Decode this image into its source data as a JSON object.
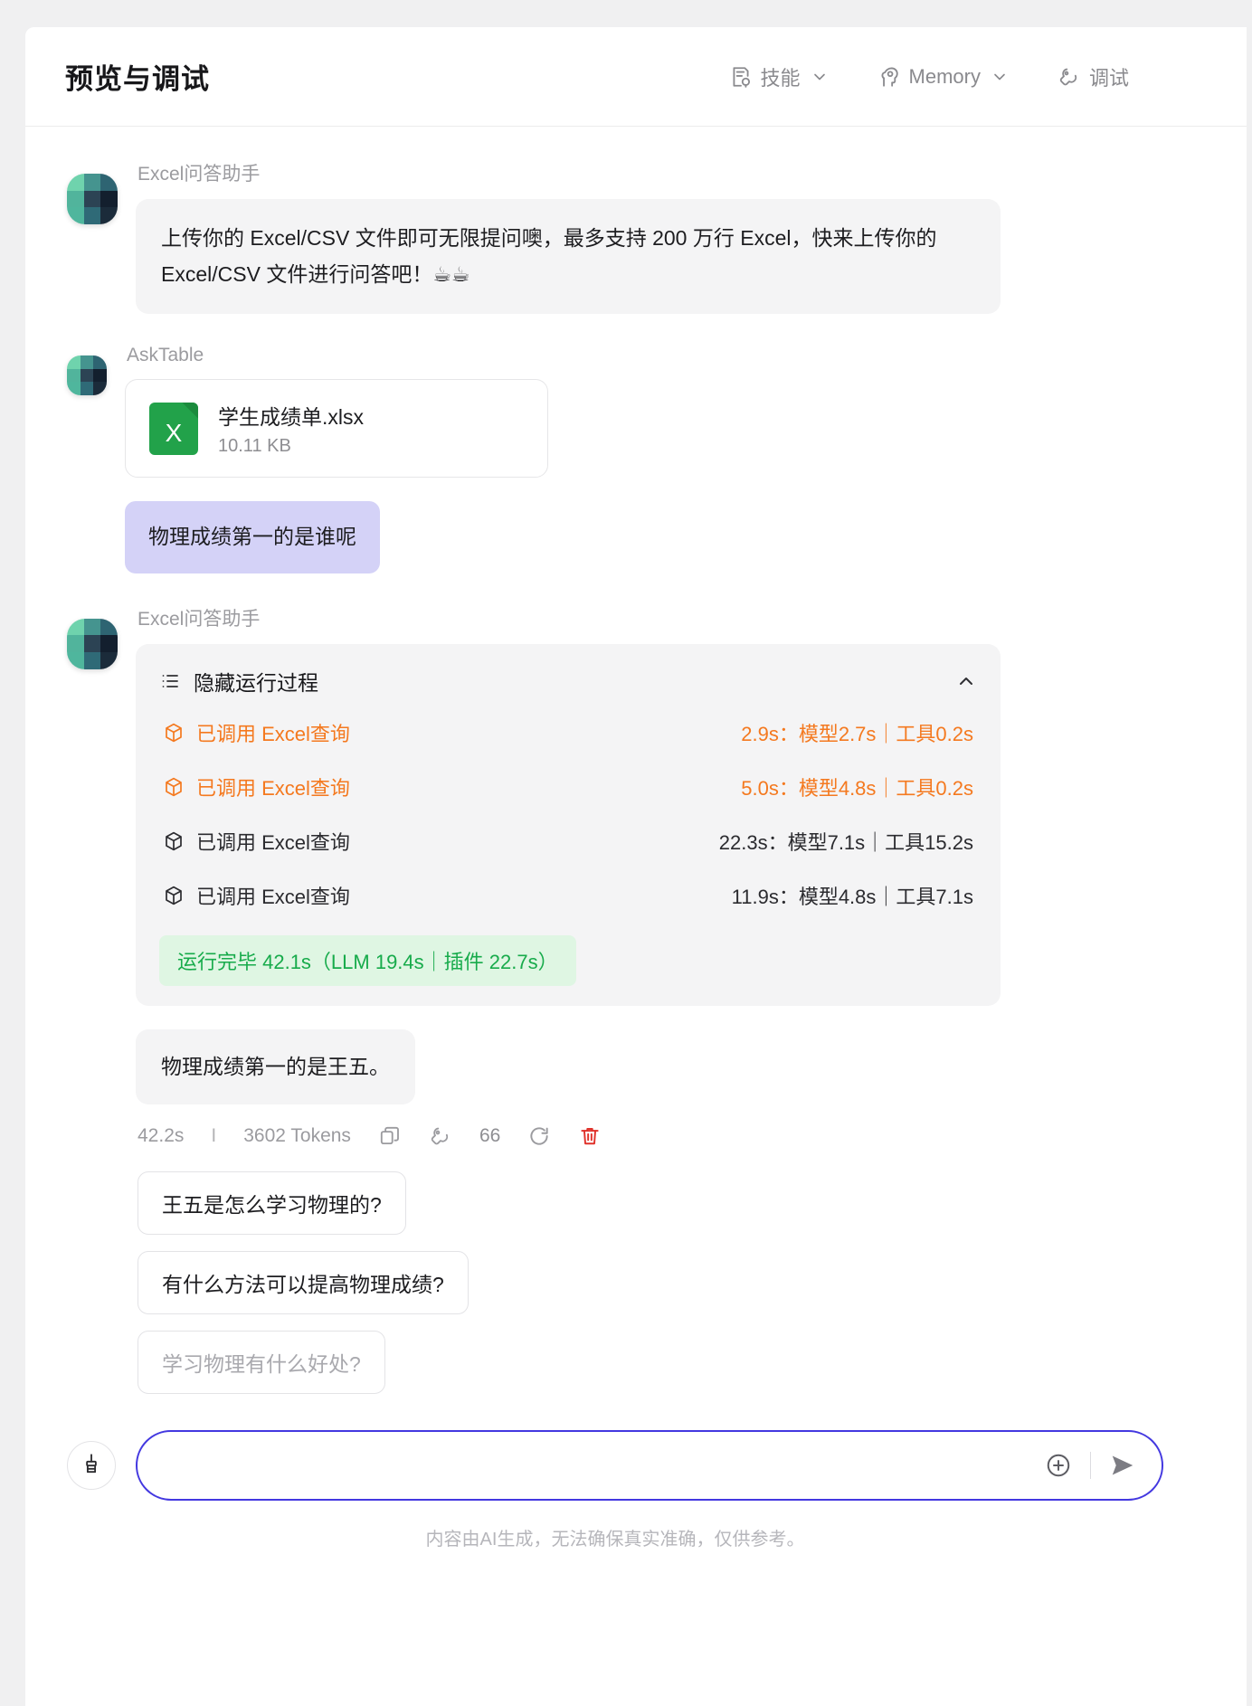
{
  "header": {
    "title": "预览与调试",
    "actions": [
      {
        "label": "技能",
        "icon": "skills-icon",
        "has_caret": true
      },
      {
        "label": "Memory",
        "icon": "memory-brain-icon",
        "has_caret": true
      },
      {
        "label": "调试",
        "icon": "wrench-icon",
        "has_caret": false
      }
    ]
  },
  "chat": {
    "intro": {
      "sender": "Excel问答助手",
      "text": "上传你的 Excel/CSV 文件即可无限提问噢，最多支持 200 万行 Excel，快来上传你的 Excel/CSV 文件进行问答吧！☕☕"
    },
    "upload": {
      "sender": "AskTable",
      "file": {
        "name": "学生成绩单.xlsx",
        "size": "10.11 KB",
        "icon": "excel-file-icon"
      },
      "user_question": "物理成绩第一的是谁呢"
    },
    "reply": {
      "sender": "Excel问答助手",
      "process": {
        "toggle_label": "隐藏运行过程",
        "toggle_icon": "list-icon",
        "caret_icon": "chevron-up-icon",
        "steps": [
          {
            "label": "已调用 Excel查询",
            "time": "2.9s：模型2.7s｜工具0.2s",
            "state": "active"
          },
          {
            "label": "已调用 Excel查询",
            "time": "5.0s：模型4.8s｜工具0.2s",
            "state": "active"
          },
          {
            "label": "已调用 Excel查询",
            "time": "22.3s：模型7.1s｜工具15.2s",
            "state": "done"
          },
          {
            "label": "已调用 Excel查询",
            "time": "11.9s：模型4.8s｜工具7.1s",
            "state": "done"
          }
        ],
        "summary": "运行完毕 42.1s（LLM 19.4s｜插件 22.7s）"
      },
      "answer": "物理成绩第一的是王五。",
      "meta": {
        "duration": "42.2s",
        "separator": "I",
        "tokens": "3602 Tokens",
        "count": "66",
        "icons": [
          "copy-icon",
          "wrench-icon",
          "refresh-icon",
          "trash-icon"
        ]
      }
    },
    "suggestions": [
      {
        "text": "王五是怎么学习物理的?",
        "muted": false
      },
      {
        "text": "有什么方法可以提高物理成绩?",
        "muted": false
      },
      {
        "text": "学习物理有什么好处?",
        "muted": true
      }
    ]
  },
  "composer": {
    "placeholder": "",
    "value": "",
    "clear_icon": "broom-icon",
    "add_icon": "plus-circle-icon",
    "send_icon": "send-icon"
  },
  "disclaimer": "内容由AI生成，无法确保真实准确，仅供参考。",
  "colors": {
    "accent": "#4338e0",
    "user_bubble": "#d4d2f7",
    "active_step": "#f4791f",
    "success": "#17ab4b",
    "success_bg": "#dff6e3",
    "excel_green": "#22a24a"
  }
}
